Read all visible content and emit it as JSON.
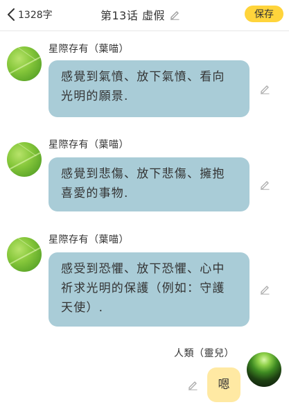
{
  "header": {
    "char_count": "1328字",
    "title": "第13话 虛假",
    "save_label": "保存"
  },
  "messages": [
    {
      "sender": "星際存有（葉喵）",
      "text": "感覺到氣憤、放下氣憤、看向\n光明的願景."
    },
    {
      "sender": "星際存有（葉喵）",
      "text": "感覺到悲傷、放下悲傷、擁抱\n喜愛的事物."
    },
    {
      "sender": "星際存有（葉喵）",
      "text": "感受到恐懼、放下恐懼、心中\n祈求光明的保護（例如：守護\n天使）."
    },
    {
      "sender": "人類（靈兒）",
      "text": "嗯"
    }
  ],
  "colors": {
    "save_button": "#ffd43b",
    "bot_bubble": "#a9ccd7",
    "user_bubble": "#ffe9a3"
  },
  "icons": [
    "chevron-left-icon",
    "pencil-icon"
  ]
}
